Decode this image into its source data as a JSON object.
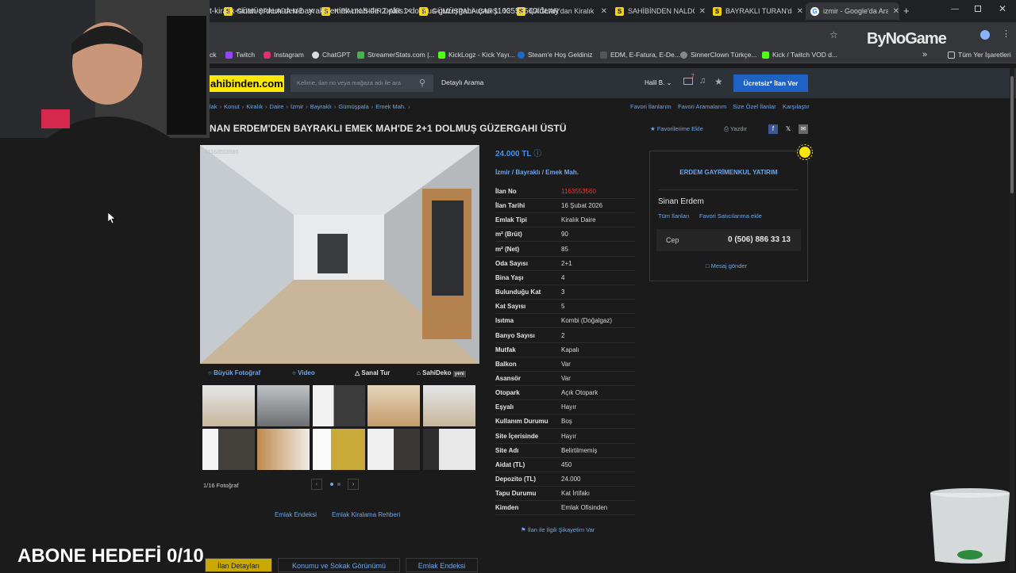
{
  "browser": {
    "tabs": [
      {
        "label": "GÜMÜŞPALADA MER",
        "icon": "sahibinden-favicon"
      },
      {
        "label": "KİRALIK SIFIR DAİRE",
        "icon": "sahibinden-favicon"
      },
      {
        "label": "GÜMÜŞPALA ÇARŞI",
        "icon": "sahibinden-favicon"
      },
      {
        "label": "ÇAĞLAR'dan Kiralık",
        "icon": "sahibinden-favicon"
      },
      {
        "label": "SAHİBİNDEN NALDÖ",
        "icon": "sahibinden-favicon"
      },
      {
        "label": "BAYRAKLI TURAN'da",
        "icon": "sahibinden-favicon"
      },
      {
        "label": "izmir - Google'da Ara",
        "icon": "google-favicon"
      }
    ],
    "new_tab": "+",
    "url": "t-kiralik-sinan-erdem-den-bayrakli-emek-mah-de-2-plus1-dolmus-guzergahi-ustu-1163553560/detay",
    "bookmarks": [
      "ck",
      "Twitch",
      "Instagram",
      "ChatGPT",
      "StreamerStats.com |...",
      "KickLogz - Kick Yayı...",
      "Steam'e Hoş Geldiniz",
      "EDM, E-Fatura, E-De...",
      "SinnerClown Türkçe...",
      "Kick / Twitch VOD d..."
    ],
    "bookmarks_more": "»",
    "all_bookmarks": "Tüm Yer İşaretleri",
    "watermark": "ByNoGame"
  },
  "site": {
    "logo": "ahibinden.com",
    "search_placeholder": "Kelime, ilan no veya mağaza adı ile ara",
    "detailed_search": "Detaylı Arama",
    "user": "Halil B.",
    "message_count": "7",
    "post_button": "Ücretsiz* İlan Ver",
    "breadcrumbs": [
      "lak",
      "Konut",
      "Kiralık",
      "Daire",
      "İzmir",
      "Bayraklı",
      "Gümüşpala",
      "Emek Mah."
    ],
    "top_links": [
      "Favori İlanlarım",
      "Favori Aramalarım",
      "Size Özel İlanlar",
      "Karşılaştır"
    ],
    "title": "NAN ERDEM'DEN BAYRAKLI EMEK MAH'DE 2+1 DOLMUŞ GÜZERGAHI ÜSTÜ",
    "add_favorite": "Favorilerime Ekle",
    "print": "Yazdır"
  },
  "listing": {
    "photo_bar": {
      "big_photo": "Büyük Fotoğraf",
      "video": "Video",
      "virtual_tour": "Sanal Tur",
      "sahideko": "SahiDeko",
      "sahideko_badge": "yeni"
    },
    "photo_count": "1/16 Fotoğraf",
    "watermark": "#1163553560",
    "price": "24.000 TL",
    "location": [
      "İzmir",
      "Bayraklı",
      "Emek Mah."
    ],
    "details": [
      {
        "k": "İlan No",
        "v": "1163553560"
      },
      {
        "k": "İlan Tarihi",
        "v": "16 Şubat 2026"
      },
      {
        "k": "Emlak Tipi",
        "v": "Kiralık Daire"
      },
      {
        "k": "m² (Brüt)",
        "v": "90"
      },
      {
        "k": "m² (Net)",
        "v": "85"
      },
      {
        "k": "Oda Sayısı",
        "v": "2+1"
      },
      {
        "k": "Bina Yaşı",
        "v": "4"
      },
      {
        "k": "Bulunduğu Kat",
        "v": "3"
      },
      {
        "k": "Kat Sayısı",
        "v": "5"
      },
      {
        "k": "Isıtma",
        "v": "Kombi (Doğalgaz)"
      },
      {
        "k": "Banyo Sayısı",
        "v": "2"
      },
      {
        "k": "Mutfak",
        "v": "Kapalı"
      },
      {
        "k": "Balkon",
        "v": "Var"
      },
      {
        "k": "Asansör",
        "v": "Var"
      },
      {
        "k": "Otopark",
        "v": "Açık Otopark"
      },
      {
        "k": "Eşyalı",
        "v": "Hayır"
      },
      {
        "k": "Kullanım Durumu",
        "v": "Boş"
      },
      {
        "k": "Site İçerisinde",
        "v": "Hayır"
      },
      {
        "k": "Site Adı",
        "v": "Belirtilmemiş"
      },
      {
        "k": "Aidat (TL)",
        "v": "450"
      },
      {
        "k": "Depozito (TL)",
        "v": "24.000"
      },
      {
        "k": "Tapu Durumu",
        "v": "Kat İrtifakı"
      },
      {
        "k": "Kimden",
        "v": "Emlak Ofisinden"
      }
    ],
    "complaint": "İlan ile İlgili Şikayetim Var",
    "footer_links": [
      "Emlak Endeksi",
      "Emlak Kiralama Rehberi"
    ]
  },
  "seller": {
    "agency": "ERDEM GAYRİMENKUL YATIRIM",
    "name": "Sinan Erdem",
    "all_listings": "Tüm İlanları",
    "add_fav_seller": "Favori Satıcılarıma ekle",
    "phone_label": "Cep",
    "phone": "0 (506) 886 33 13",
    "message": "Mesaj gönder"
  },
  "bottom_tabs": [
    "İlan Detayları",
    "Konumu ve Sokak Görünümü",
    "Emlak Endeksi"
  ],
  "overlay": {
    "subscriber_goal": "ABONE HEDEFİ 0/10"
  },
  "colors": {
    "brand_yellow": "#ffe800",
    "link_blue": "#6fa6e8",
    "button_blue": "#1e63c4",
    "ilan_no_red": "#e33333"
  }
}
